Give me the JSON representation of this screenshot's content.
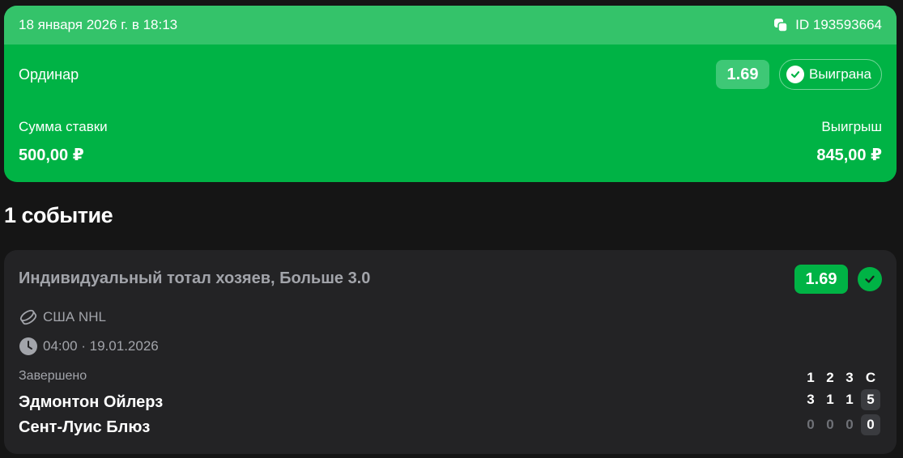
{
  "bet": {
    "datetime": "18 января 2026 г. в 18:13",
    "id_text": "ID 193593664",
    "type": "Ординар",
    "odds": "1.69",
    "status": "Выиграна",
    "stake_label": "Сумма ставки",
    "stake_value": "500,00 ₽",
    "win_label": "Выигрыш",
    "win_value": "845,00 ₽"
  },
  "events_title": "1 событие",
  "event": {
    "market": "Индивидуальный тотал хозяев, Больше 3.0",
    "odds": "1.69",
    "league_icon": "hockey-puck-icon",
    "league": "США NHL",
    "time_icon": "clock-icon",
    "datetime": "04:00 · 19.01.2026",
    "status": "Завершено",
    "score_headers": [
      "1",
      "2",
      "3",
      "С"
    ],
    "home_team": "Эдмонтон Ойлерз",
    "away_team": "Сент-Луис Блюз",
    "home_scores": [
      "3",
      "1",
      "1",
      "5"
    ],
    "away_scores": [
      "0",
      "0",
      "0",
      "0"
    ]
  },
  "colors": {
    "background": "#151515",
    "win_green": "#00b345",
    "header_green": "#34c36a",
    "card_dark": "#232325",
    "muted_text": "#a2a4aa"
  }
}
